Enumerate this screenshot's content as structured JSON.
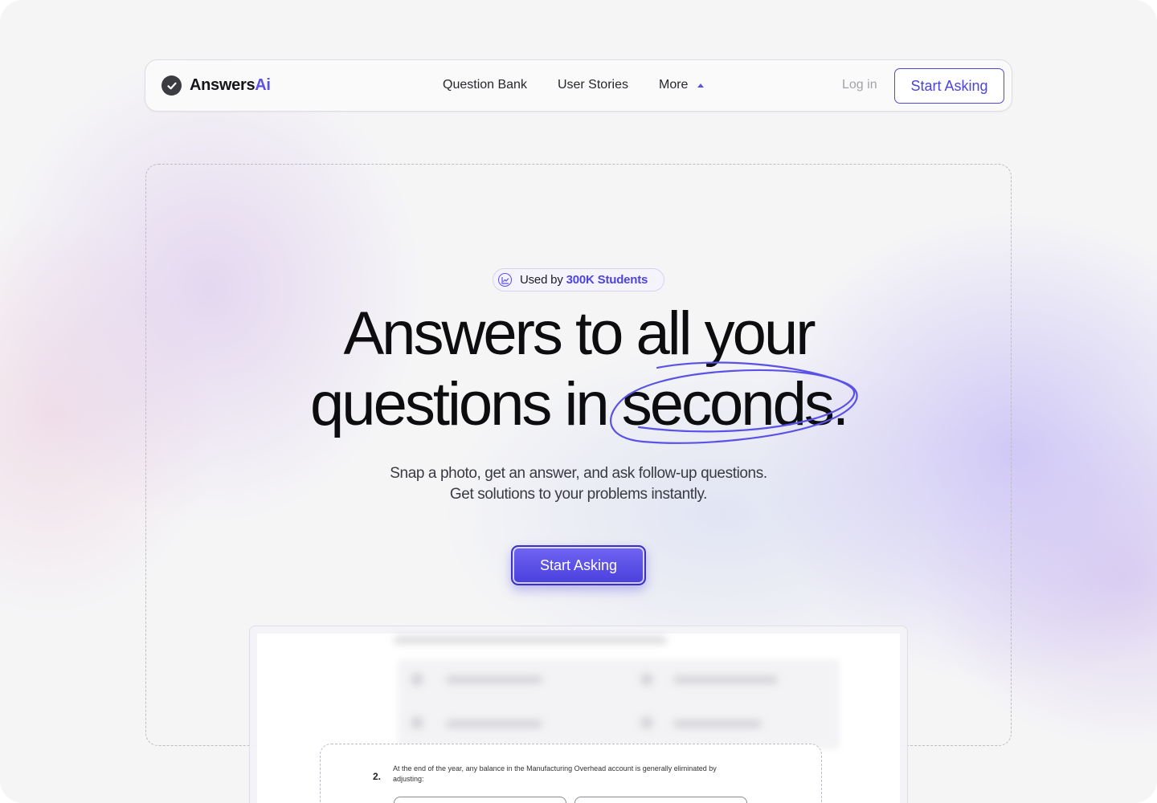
{
  "nav": {
    "brand_main": "Answers",
    "brand_accent": "Ai",
    "links": [
      {
        "label": "Question Bank"
      },
      {
        "label": "User Stories"
      },
      {
        "label": "More"
      }
    ],
    "login_label": "Log in",
    "cta_label": "Start Asking"
  },
  "hero": {
    "badge_prefix": "Used by",
    "badge_highlight": "300K Students",
    "headline_line1": "Answers to all your",
    "headline_line2_start": "questions in ",
    "headline_line2_emph": "seconds.",
    "subtitle": "Snap a photo, get an answer, and ask follow-up questions. Get solutions to your problems instantly.",
    "cta_label": "Start Asking"
  },
  "preview": {
    "question_number": "2.",
    "question_text": "At the end of the year, any balance in the Manufacturing Overhead account is generally eliminated by adjusting:"
  },
  "colors": {
    "accent": "#5a52e6",
    "cta_gradient_top": "#7065f2",
    "cta_gradient_bottom": "#4a3fdc"
  }
}
